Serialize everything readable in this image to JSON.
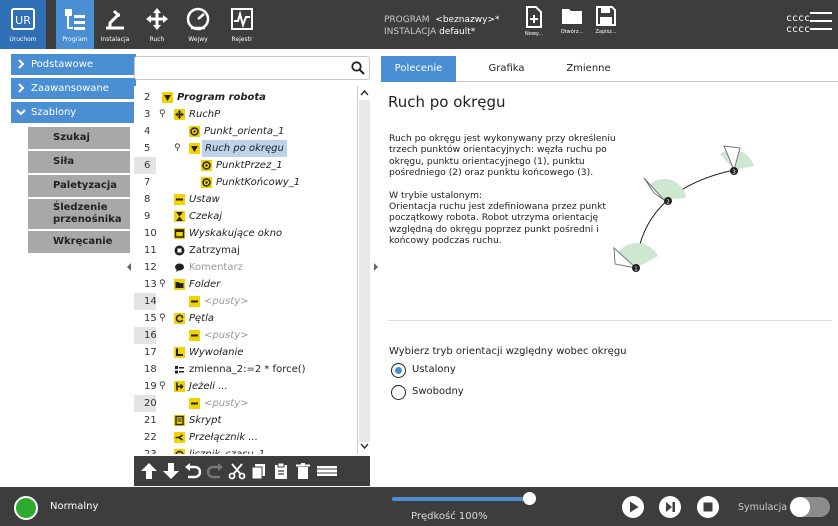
{
  "header": {
    "nav": [
      {
        "label": "Uruchom"
      },
      {
        "label": "Program"
      },
      {
        "label": "Instalacja"
      },
      {
        "label": "Ruch"
      },
      {
        "label": "Wejwy"
      },
      {
        "label": "Rejestr"
      }
    ],
    "program_label": "PROGRAM",
    "program_name": "<beznazwy>*",
    "install_label": "INSTALACJA",
    "install_name": "default*",
    "file_buttons": [
      {
        "label": "Nowy..."
      },
      {
        "label": "Otwórz..."
      },
      {
        "label": "Zapisz..."
      }
    ],
    "user_line1": "cccc",
    "user_line2": "cccc"
  },
  "sidebar": {
    "categories": [
      {
        "label": "Podstawowe",
        "expanded": false
      },
      {
        "label": "Zaawansowane",
        "expanded": false
      },
      {
        "label": "Szablony",
        "expanded": true
      }
    ],
    "templates": [
      {
        "label": "Szukaj"
      },
      {
        "label": "Siła"
      },
      {
        "label": "Paletyzacja"
      },
      {
        "label": "Śledzenie przenośnika",
        "l1": "Śledzenie",
        "l2": "przenośnika"
      },
      {
        "label": "Wkręcanie"
      }
    ]
  },
  "tree": {
    "search_value": "",
    "rows": [
      {
        "n": "2",
        "text": "Program robota"
      },
      {
        "n": "3",
        "text": "RuchP"
      },
      {
        "n": "4",
        "text": "Punkt_orienta_1"
      },
      {
        "n": "5",
        "text": "Ruch po okręgu"
      },
      {
        "n": "6",
        "text": "PunktPrzez_1"
      },
      {
        "n": "7",
        "text": "PunktKońcowy_1"
      },
      {
        "n": "8",
        "text": "Ustaw"
      },
      {
        "n": "9",
        "text": "Czekaj"
      },
      {
        "n": "10",
        "text": "Wyskakujące okno"
      },
      {
        "n": "11",
        "text": "Zatrzymaj"
      },
      {
        "n": "12",
        "text": "Komentarz"
      },
      {
        "n": "13",
        "text": "Folder"
      },
      {
        "n": "14",
        "text": "<pusty>"
      },
      {
        "n": "15",
        "text": "Pętla"
      },
      {
        "n": "16",
        "text": "<pusty>"
      },
      {
        "n": "17",
        "text": "Wywołanie"
      },
      {
        "n": "18",
        "text": "zmienna_2:=2 * force()"
      },
      {
        "n": "19",
        "text": "Jeżeli ..."
      },
      {
        "n": "20",
        "text": "<pusty>"
      },
      {
        "n": "21",
        "text": "Skrypt"
      },
      {
        "n": "22",
        "text": "Przełącznik ..."
      },
      {
        "n": "23",
        "text": "licznik_czasu_1"
      }
    ]
  },
  "tabs": [
    {
      "label": "Polecenie"
    },
    {
      "label": "Grafika"
    },
    {
      "label": "Zmienne"
    }
  ],
  "command": {
    "title": "Ruch po okręgu",
    "para1": "Ruch po okręgu jest wykonywany przy określeniu trzech punktów orientacyjnych: węzła ruchu po okręgu, punktu orientacyjnego (1), punktu pośredniego (2) oraz punktu końcowego (3).",
    "para2_head": "W trybie ustalonym:",
    "para2_body": "Orientacja ruchu jest zdefiniowana przez punkt początkowy robota. Robot utrzyma orientację względną do okręgu poprzez punkt pośredni i końcowy podczas ruchu.",
    "diagram_labels": [
      "1",
      "2",
      "3"
    ],
    "orient_label": "Wybierz tryb orientacji względny wobec okręgu",
    "options": [
      {
        "label": "Ustalony",
        "selected": true
      },
      {
        "label": "Swobodny",
        "selected": false
      }
    ]
  },
  "footer": {
    "status": "Normalny",
    "speed_text": "Prędkość 100%",
    "speed_fraction": 1.0,
    "sim_label": "Symulacja",
    "sim_on": false
  },
  "colors": {
    "accent": "#4a8fd4",
    "header_bg": "#3d3d3d",
    "status_ok": "#2eaa2e",
    "selection": "#bcd3ea",
    "template_bg": "#a8a8a8"
  }
}
